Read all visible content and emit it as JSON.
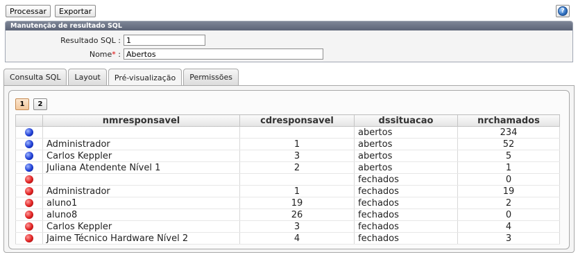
{
  "toolbar": {
    "processar_label": "Processar",
    "exportar_label": "Exportar",
    "help_glyph": "?"
  },
  "panel": {
    "title": "Manutenção de resultado SQL",
    "resultado_label": "Resultado SQL :",
    "resultado_value": "1",
    "nome_label": "Nome",
    "nome_required": "*",
    "nome_colon": " :",
    "nome_value": "Abertos"
  },
  "tabs": [
    {
      "label": "Consulta SQL"
    },
    {
      "label": "Layout"
    },
    {
      "label": "Pré-visualização"
    },
    {
      "label": "Permissões"
    }
  ],
  "active_tab": 2,
  "pager": {
    "pages": [
      "1",
      "2"
    ],
    "current": "1"
  },
  "table": {
    "columns": [
      "nmresponsavel",
      "cdresponsavel",
      "dssituacao",
      "nrchamados"
    ],
    "rows": [
      {
        "status": "blue",
        "nmresponsavel": "",
        "cdresponsavel": "",
        "dssituacao": "abertos",
        "nrchamados": "234"
      },
      {
        "status": "blue",
        "nmresponsavel": "Administrador",
        "cdresponsavel": "1",
        "dssituacao": "abertos",
        "nrchamados": "52"
      },
      {
        "status": "blue",
        "nmresponsavel": "Carlos Keppler",
        "cdresponsavel": "3",
        "dssituacao": "abertos",
        "nrchamados": "5"
      },
      {
        "status": "blue",
        "nmresponsavel": "Juliana Atendente Nível 1",
        "cdresponsavel": "2",
        "dssituacao": "abertos",
        "nrchamados": "1"
      },
      {
        "status": "red",
        "nmresponsavel": "",
        "cdresponsavel": "",
        "dssituacao": "fechados",
        "nrchamados": "0"
      },
      {
        "status": "red",
        "nmresponsavel": "Administrador",
        "cdresponsavel": "1",
        "dssituacao": "fechados",
        "nrchamados": "19"
      },
      {
        "status": "red",
        "nmresponsavel": "aluno1",
        "cdresponsavel": "19",
        "dssituacao": "fechados",
        "nrchamados": "2"
      },
      {
        "status": "red",
        "nmresponsavel": "aluno8",
        "cdresponsavel": "26",
        "dssituacao": "fechados",
        "nrchamados": "0"
      },
      {
        "status": "red",
        "nmresponsavel": "Carlos Keppler",
        "cdresponsavel": "3",
        "dssituacao": "fechados",
        "nrchamados": "4"
      },
      {
        "status": "red",
        "nmresponsavel": "Jaime Técnico Hardware Nível 2",
        "cdresponsavel": "4",
        "dssituacao": "fechados",
        "nrchamados": "3"
      }
    ]
  },
  "colors": {
    "panel_header": "#5c6477",
    "status_blue": "#1f3fd6",
    "status_red": "#e02020"
  }
}
